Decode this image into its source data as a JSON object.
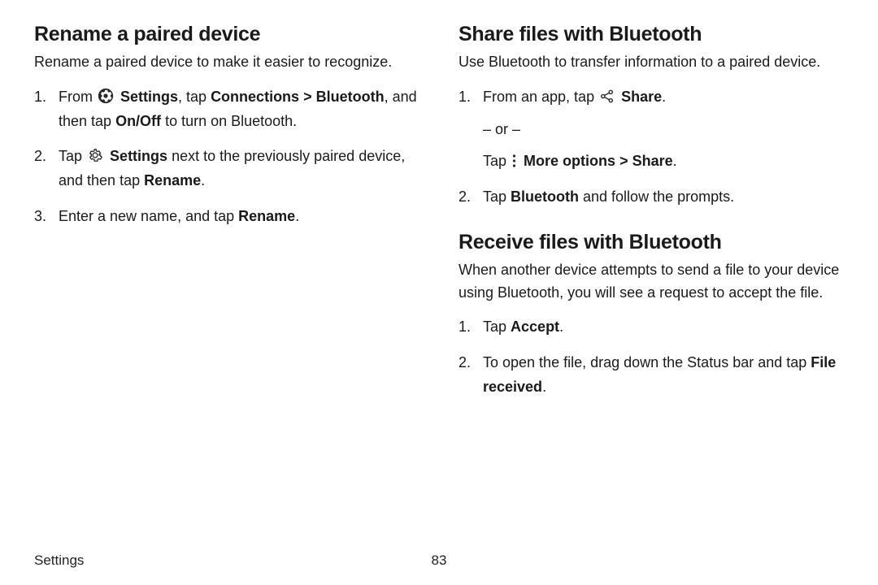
{
  "left": {
    "heading": "Rename a paired device",
    "intro": "Rename a paired device to make it easier to recognize.",
    "step1": {
      "pre": "From ",
      "settings": "Settings",
      "mid1": ", tap ",
      "connections": "Connections",
      "bluetooth": "Bluetooth",
      "mid2": ", and then tap ",
      "onoff": "On/Off",
      "tail": " to turn on Bluetooth."
    },
    "step2": {
      "pre": "Tap ",
      "settings": "Settings",
      "mid": " next to the previously paired device, and then tap ",
      "rename": "Rename",
      "tail": "."
    },
    "step3": {
      "pre": "Enter a new name, and tap ",
      "rename": "Rename",
      "tail": "."
    }
  },
  "right_share": {
    "heading": "Share files with Bluetooth",
    "intro": "Use Bluetooth to transfer information to a paired device.",
    "step1": {
      "pre": "From an app, tap ",
      "share": "Share",
      "tail": ".",
      "or": "– or –",
      "tap": "Tap ",
      "more": "More options",
      "share2": "Share",
      "tail2": "."
    },
    "step2": {
      "pre": "Tap ",
      "bluetooth": "Bluetooth",
      "tail": " and follow the prompts."
    }
  },
  "right_receive": {
    "heading": "Receive files with Bluetooth",
    "intro": "When another device attempts to send a file to your device using Bluetooth, you will see a request to accept the file.",
    "step1": {
      "pre": "Tap ",
      "accept": "Accept",
      "tail": "."
    },
    "step2": {
      "pre": "To open the file, drag down the Status bar and tap ",
      "file": "File received",
      "tail": "."
    }
  },
  "footer": {
    "section": "Settings",
    "page": "83"
  },
  "chevron": ">"
}
